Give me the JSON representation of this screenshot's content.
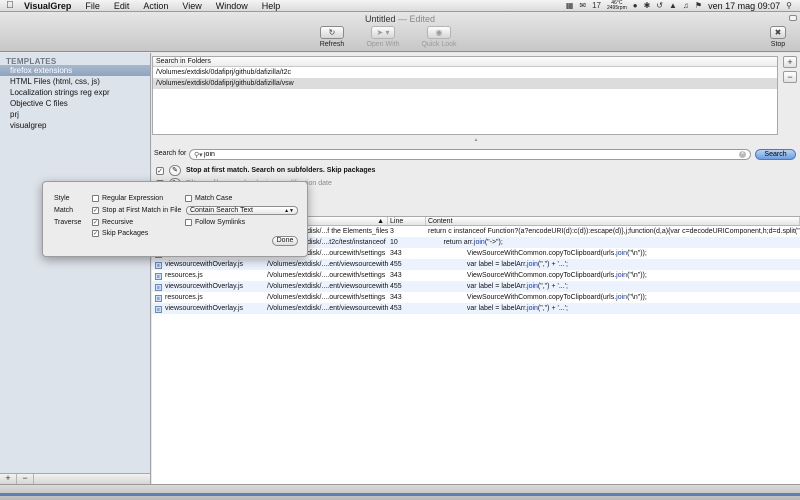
{
  "menubar": {
    "apple": "",
    "app_name": "VisualGrep",
    "menus": [
      "File",
      "Edit",
      "Action",
      "View",
      "Window",
      "Help"
    ],
    "temp_top": "46°C",
    "temp_bottom": "2495rpm",
    "calendar_day": "17",
    "flag_icon": "us-flag-icon",
    "clock": "ven 17 mag  09:07"
  },
  "window": {
    "title": "Untitled",
    "edited": "— Edited"
  },
  "toolbar": {
    "refresh": "Refresh",
    "open_with": "Open With",
    "quick_look": "Quick Look",
    "stop": "Stop"
  },
  "sidebar": {
    "header": "TEMPLATES",
    "items": [
      "firefox extensions",
      "HTML Files (html, css, js)",
      "Localization strings reg expr",
      "Objective C files",
      "prj",
      "visualgrep"
    ],
    "add": "+",
    "remove": "−"
  },
  "folders": {
    "header": "Search in Folders",
    "rows": [
      "/Volumes/extdisk/0dafiprj/github/dafizilla/t2c",
      "/Volumes/extdisk/0dafiprj/github/dafizilla/vsw"
    ],
    "add": "+",
    "remove": "−"
  },
  "search": {
    "label": "Search for",
    "value": "join",
    "button": "Search"
  },
  "options": {
    "content_summary": "Stop at first match. Search on subfolders. Skip packages",
    "file_summary": "Filter on file name (css), size, modification date"
  },
  "popover": {
    "style_label": "Style",
    "match_label": "Match",
    "traverse_label": "Traverse",
    "regular_expression": "Regular Expression",
    "match_case": "Match Case",
    "stop_first": "Stop at First Match in File",
    "recursive": "Recursive",
    "follow_symlinks": "Follow Symlinks",
    "skip_packages": "Skip Packages",
    "match_mode": "Contain Search Text",
    "done": "Done"
  },
  "results": {
    "columns": {
      "line": "Line",
      "content": "Content"
    },
    "rows": [
      {
        "file": "",
        "path": "/Volumes/extdisk/...f the Elements_files",
        "line": "3",
        "pre": "return c instanceof Function?(a?encodeURI(d):c(d)):escape(d)},j;function(d,a){var c=decodeURIComponent,h;d=d.split(\"=\").",
        "kw": "join",
        "post": ""
      },
      {
        "file": "",
        "path": "/Volumes/extdisk/....t2c/test/instanceof",
        "line": "10",
        "pre": "        return arr.",
        "kw": "join",
        "post": "(\"->\");"
      },
      {
        "file": "",
        "path": "/Volumes/extdisk/....ourcewith/settings",
        "line": "343",
        "pre": "                    ViewSourceWithCommon.copyToClipboard(urls.",
        "kw": "join",
        "post": "(\"\\n\"));"
      },
      {
        "file": "viewsourcewithOverlay.js",
        "path": "/Volumes/extdisk/....ent/viewsourcewith",
        "line": "455",
        "pre": "                    var label = labelArr.",
        "kw": "join",
        "post": "(\",\") + '...';"
      },
      {
        "file": "resources.js",
        "path": "/Volumes/extdisk/....ourcewith/settings",
        "line": "343",
        "pre": "                    ViewSourceWithCommon.copyToClipboard(urls.",
        "kw": "join",
        "post": "(\"\\n\"));"
      },
      {
        "file": "viewsourcewithOverlay.js",
        "path": "/Volumes/extdisk/....ent/viewsourcewith",
        "line": "455",
        "pre": "                    var label = labelArr.",
        "kw": "join",
        "post": "(\",\") + '...';"
      },
      {
        "file": "resources.js",
        "path": "/Volumes/extdisk/....ourcewith/settings",
        "line": "343",
        "pre": "                    ViewSourceWithCommon.copyToClipboard(urls.",
        "kw": "join",
        "post": "(\"\\n\"));"
      },
      {
        "file": "viewsourcewithOverlay.js",
        "path": "/Volumes/extdisk/....ent/viewsourcewith",
        "line": "453",
        "pre": "                    var label = labelArr.",
        "kw": "join",
        "post": "(\",\") + '...';"
      }
    ]
  },
  "colors": {
    "accent": "#6d9ee0",
    "selection": "#8ea3bd",
    "keyword": "#1238b0"
  }
}
